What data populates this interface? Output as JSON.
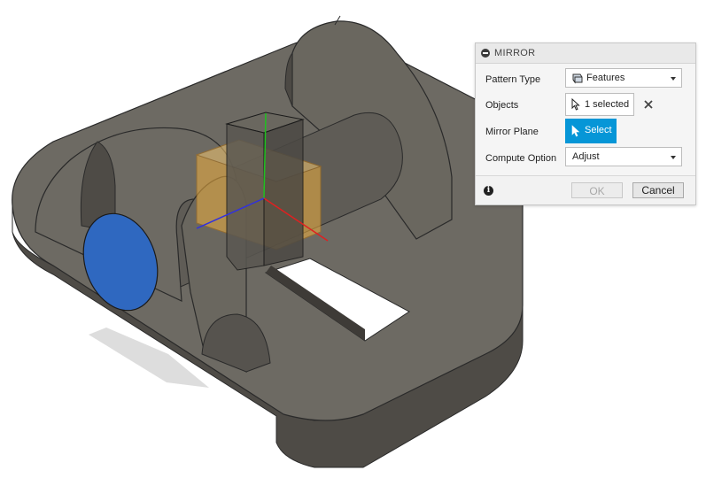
{
  "viewport": {
    "model_colors": {
      "body": "#6d6a63",
      "edge": "#2a2a2a",
      "shaft": "#5f5c56",
      "selected_face": "#2f68c0",
      "gizmo": "#f0b040"
    },
    "triad_colors": {
      "x": "#e02020",
      "y": "#20c020",
      "z": "#3030e0"
    }
  },
  "mirror_dialog": {
    "title": "MIRROR",
    "collapse_icon": "minus-circle-icon",
    "rows": {
      "pattern_type": {
        "label": "Pattern Type",
        "value": "Features",
        "icon": "features-icon"
      },
      "objects": {
        "label": "Objects",
        "button_label": "1 selected",
        "icon": "cursor-icon",
        "clear_icon": "close-icon"
      },
      "mirror_plane": {
        "label": "Mirror Plane",
        "button_label": "Select",
        "icon": "cursor-icon",
        "accent": "#0696d7"
      },
      "compute_option": {
        "label": "Compute Option",
        "value": "Adjust"
      }
    },
    "footer": {
      "info_icon": "info-icon",
      "ok_label": "OK",
      "cancel_label": "Cancel"
    }
  }
}
